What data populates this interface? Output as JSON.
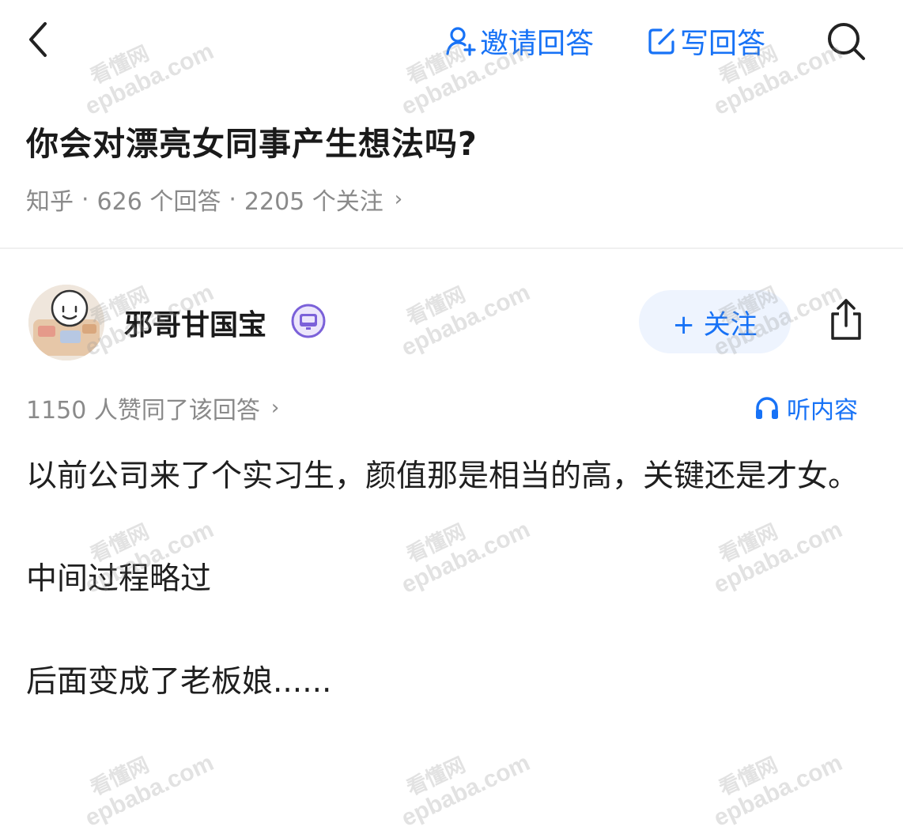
{
  "nav": {
    "back_icon": "chevron-left-icon",
    "invite_label": "邀请回答",
    "write_label": "写回答",
    "search_icon": "search-icon"
  },
  "question": {
    "title": "你会对漂亮女同事产生想法吗?",
    "source": "知乎",
    "answers_count": "626 个回答",
    "followers_count": "2205 个关注"
  },
  "answer": {
    "author_name": "邪哥甘国宝",
    "follow_label": "+ 关注",
    "votes_text": "1150 人赞同了该回答",
    "listen_label": "听内容",
    "paragraphs": [
      "以前公司来了个实习生，颜值那是相当的高，关键还是才女。",
      "中间过程略过",
      "后面变成了老板娘......"
    ]
  },
  "watermark": {
    "line1": "看懂网",
    "line2": "epbaba.com"
  },
  "colors": {
    "accent": "#1772f6",
    "meta_gray": "#8a8a8a",
    "follow_bg": "#eef4fe"
  }
}
